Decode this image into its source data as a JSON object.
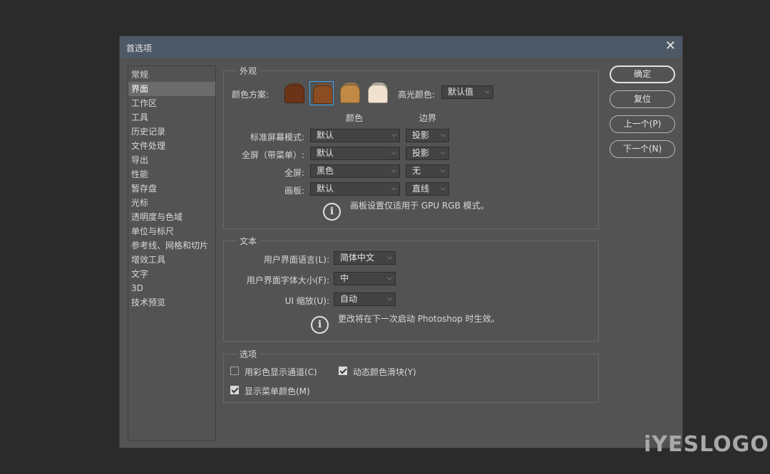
{
  "dialog": {
    "title": "首选项",
    "close_glyph": "✕"
  },
  "sidebar": {
    "items": [
      {
        "label": "常规"
      },
      {
        "label": "界面",
        "active": true
      },
      {
        "label": "工作区"
      },
      {
        "label": "工具"
      },
      {
        "label": "历史记录"
      },
      {
        "label": "文件处理"
      },
      {
        "label": "导出"
      },
      {
        "label": "性能"
      },
      {
        "label": "暂存盘"
      },
      {
        "label": "光标"
      },
      {
        "label": "透明度与色域"
      },
      {
        "label": "单位与标尺"
      },
      {
        "label": "参考线、网格和切片"
      },
      {
        "label": "增效工具"
      },
      {
        "label": "文字"
      },
      {
        "label": "3D"
      },
      {
        "label": "技术预览"
      }
    ]
  },
  "appearance": {
    "group_label": "外观",
    "color_scheme_label": "颜色方案:",
    "color_schemes": [
      {
        "color": "#6b3418",
        "selected": false
      },
      {
        "color": "#8a4c22",
        "selected": true
      },
      {
        "color": "#c08a46",
        "selected": false
      },
      {
        "color": "#f0e2cf",
        "selected": false
      }
    ],
    "highlight_label": "高光颜色:",
    "highlight_value": "默认值",
    "col_color": "颜色",
    "col_border": "边界",
    "rows": [
      {
        "label": "标准屏幕模式:",
        "color": "默认",
        "border": "投影"
      },
      {
        "label": "全屏（带菜单）:",
        "color": "默认",
        "border": "投影"
      },
      {
        "label": "全屏:",
        "color": "黑色",
        "border": "无"
      },
      {
        "label": "画板:",
        "color": "默认",
        "border": "直线"
      }
    ],
    "info_icon": "i",
    "info_text": "画板设置仅适用于 GPU RGB 模式。"
  },
  "text": {
    "group_label": "文本",
    "language_label": "用户界面语言(L):",
    "language_value": "简体中文",
    "fontsize_label": "用户界面字体大小(F):",
    "fontsize_value": "中",
    "scale_label": "UI 缩放(U):",
    "scale_value": "自动",
    "info_icon": "i",
    "info_text": "更改将在下一次启动 Photoshop 时生效。"
  },
  "options": {
    "group_label": "选项",
    "show_channels_color": {
      "label": "用彩色显示通道(C)",
      "checked": false
    },
    "dynamic_sliders": {
      "label": "动态颜色滑块(Y)",
      "checked": true
    },
    "show_menu_colors": {
      "label": "显示菜单颜色(M)",
      "checked": true
    }
  },
  "buttons": {
    "ok": "确定",
    "reset": "复位",
    "prev": "上一个(P)",
    "next": "下一个(N)"
  },
  "watermark": "iYESLOGO"
}
